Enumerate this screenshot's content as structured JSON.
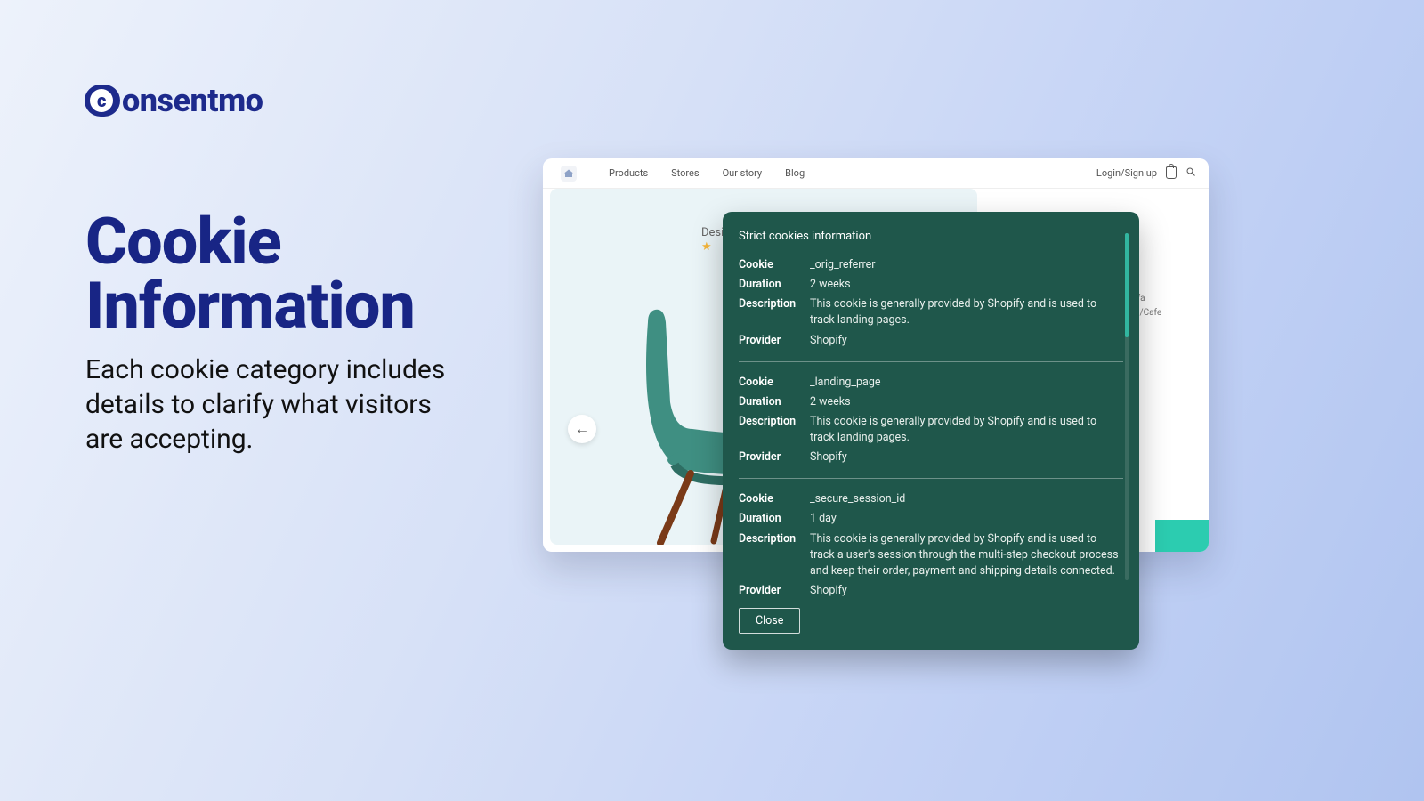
{
  "brand": {
    "name_rest": "onsentmo"
  },
  "headline_line1": "Cookie",
  "headline_line2": "Information",
  "subcopy": "Each cookie category includes details to clarify what visitors are accepting.",
  "browser": {
    "nav": {
      "products": "Products",
      "stores": "Stores",
      "story": "Our story",
      "blog": "Blog"
    },
    "login": "Login/Sign up",
    "design_label": "Desig",
    "right_meta_1": "Sofa",
    "right_meta_2": "om/Cafe"
  },
  "modal": {
    "title": "Strict cookies information",
    "labels": {
      "cookie": "Cookie",
      "duration": "Duration",
      "description": "Description",
      "provider": "Provider"
    },
    "close": "Close",
    "cookies": [
      {
        "name": "_orig_referrer",
        "duration": "2 weeks",
        "description": "This cookie is generally provided by Shopify and is used to track landing pages.",
        "provider": "Shopify"
      },
      {
        "name": "_landing_page",
        "duration": "2 weeks",
        "description": "This cookie is generally provided by Shopify and is used to track landing pages.",
        "provider": "Shopify"
      },
      {
        "name": "_secure_session_id",
        "duration": "1 day",
        "description": "This cookie is generally provided by Shopify and is used to track a user's session through the multi-step checkout process and keep their order, payment and shipping details connected.",
        "provider": "Shopify"
      }
    ]
  }
}
